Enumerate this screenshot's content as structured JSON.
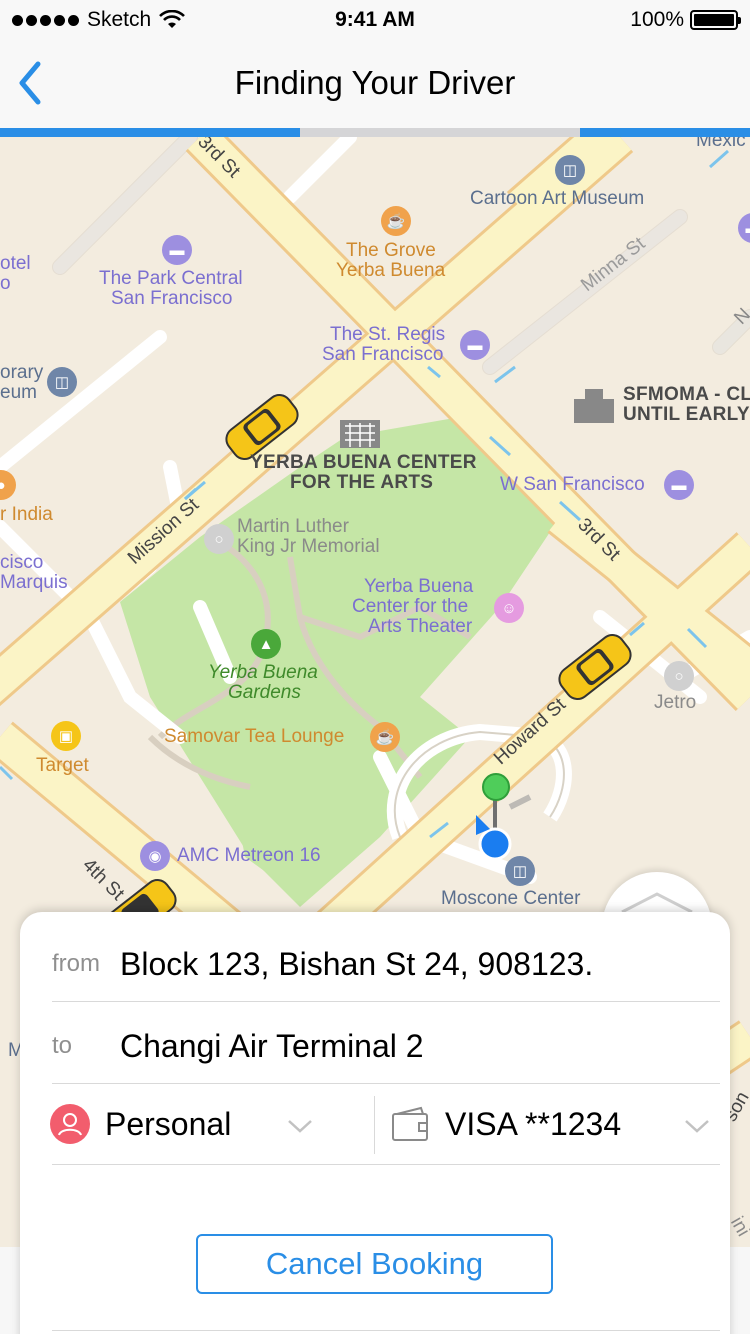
{
  "status_bar": {
    "carrier": "Sketch",
    "time": "9:41 AM",
    "battery": "100%",
    "signal_icon": "signal-dots-icon",
    "wifi_icon": "wifi-icon",
    "battery_icon": "battery-icon"
  },
  "nav": {
    "title": "Finding Your Driver",
    "back_icon": "chevron-left-icon"
  },
  "colors": {
    "accent": "#2a8ee6",
    "map_bg": "#f3ecdf",
    "park": "#c5e6a6",
    "road": "#fbf4c6",
    "road_edge": "#efc98a",
    "personal": "#f25d6d"
  },
  "map": {
    "streets": {
      "third_top": "3rd St",
      "minna": "Minna St",
      "mission": "Mission St",
      "third": "3rd St",
      "howard": "Howard St",
      "fourth": "4th St",
      "partial_n": "N"
    },
    "pois": {
      "mexico": "Mexic",
      "cartoon": "Cartoon Art Museum",
      "grove_1": "The Grove",
      "grove_2": "Yerba Buena",
      "hotel": "otel",
      "hotel_2": "o",
      "park_central_1": "The Park Central",
      "park_central_2": "San Francisco",
      "st_regis_1": "The St. Regis",
      "st_regis_2": "San Francisco",
      "library_1": "orary",
      "library_2": "eum",
      "sfmoma_1": "SFMOMA - CL",
      "sfmoma_2": "UNTIL EARLY",
      "ybca_1": "YERBA BUENA CENTER",
      "ybca_2": "FOR THE ARTS",
      "w_sf": "W San Francisco",
      "india": "r India",
      "mlk_1": "Martin Luther",
      "mlk_2": "King Jr Memorial",
      "marquis_1": "cisco",
      "marquis_2": "Marquis",
      "yb_theater_1": "Yerba Buena",
      "yb_theater_2": "Center for the",
      "yb_theater_3": "Arts Theater",
      "yb_gardens_1": "Yerba Buena",
      "yb_gardens_2": "Gardens",
      "jetro": "Jetro",
      "samovar": "Samovar Tea Lounge",
      "target": "Target",
      "amc": "AMC Metreon 16",
      "moscone": "Moscone Center",
      "m_partial": "M",
      "scon_partial": "son",
      "ini_partial": "ini"
    }
  },
  "booking": {
    "from_label": "from",
    "from_value": "Block 123, Bishan St 24, 908123.",
    "to_label": "to",
    "to_value": "Changi Air Terminal 2",
    "profile": "Personal",
    "payment": "VISA **1234",
    "cancel_label": "Cancel Booking"
  }
}
